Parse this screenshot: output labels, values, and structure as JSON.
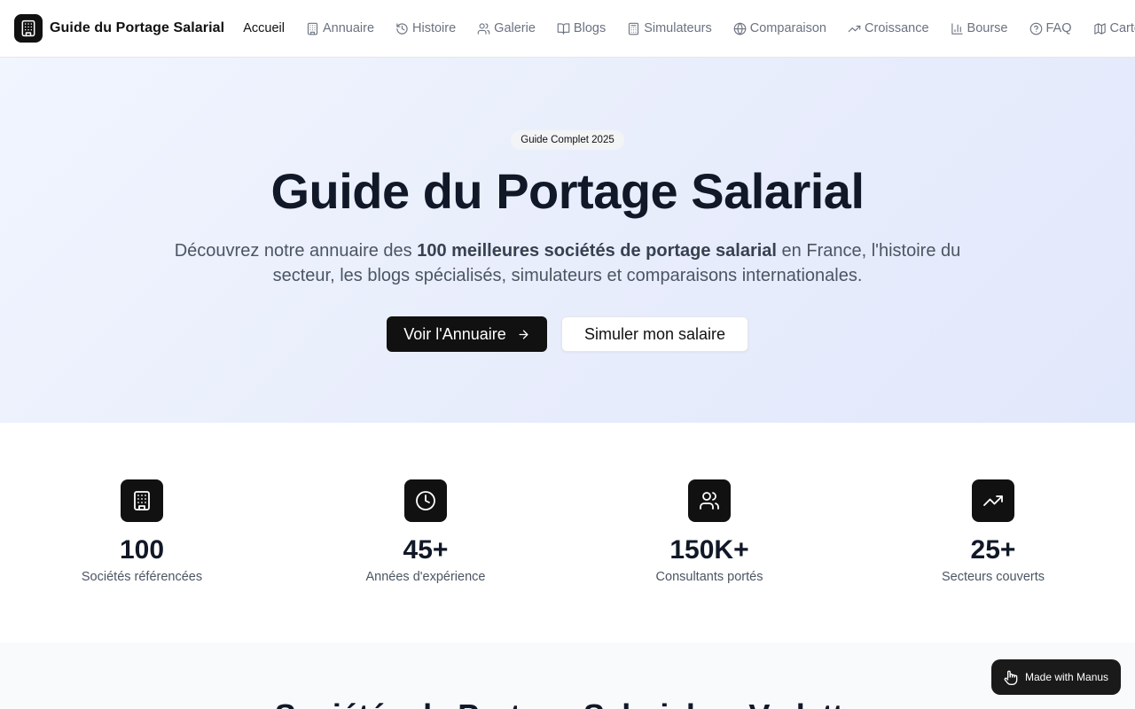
{
  "header": {
    "brand_name": "Guide du Portage Salarial",
    "brand_icon": "building-icon",
    "nav": [
      {
        "label": "Accueil",
        "icon": "",
        "active": true
      },
      {
        "label": "Annuaire",
        "icon": "building-icon"
      },
      {
        "label": "Histoire",
        "icon": "history-icon"
      },
      {
        "label": "Galerie",
        "icon": "users-icon"
      },
      {
        "label": "Blogs",
        "icon": "book-icon"
      },
      {
        "label": "Simulateurs",
        "icon": "calculator-icon"
      },
      {
        "label": "Comparaison",
        "icon": "globe-icon"
      },
      {
        "label": "Croissance",
        "icon": "trending-up-icon"
      },
      {
        "label": "Bourse",
        "icon": "bar-chart-icon"
      },
      {
        "label": "FAQ",
        "icon": "help-circle-icon"
      },
      {
        "label": "Carte",
        "icon": "map-icon"
      }
    ]
  },
  "hero": {
    "badge": "Guide Complet 2025",
    "title": "Guide du Portage Salarial",
    "desc_before": "Découvrez notre annuaire des ",
    "desc_bold": "100 meilleures sociétés de portage salarial",
    "desc_after": " en France, l'histoire du secteur, les blogs spécialisés, simulateurs et comparaisons internationales.",
    "primary_button": "Voir l'Annuaire",
    "secondary_button": "Simuler mon salaire"
  },
  "stats": [
    {
      "value": "100",
      "label": "Sociétés référencées",
      "icon": "building-icon"
    },
    {
      "value": "45+",
      "label": "Années d'expérience",
      "icon": "clock-icon"
    },
    {
      "value": "150K+",
      "label": "Consultants portés",
      "icon": "users-icon"
    },
    {
      "value": "25+",
      "label": "Secteurs couverts",
      "icon": "trending-up-icon"
    }
  ],
  "section2": {
    "title": "Sociétés de Portage Salarial en Vedette"
  },
  "manus_badge": {
    "label": "Made with Manus",
    "icon": "manus-hand-icon"
  },
  "colors": {
    "primary": "#111111",
    "hero_bg_start": "#f1f5fe",
    "hero_bg_end": "#e2e8fb",
    "text_muted": "#6b7280"
  }
}
